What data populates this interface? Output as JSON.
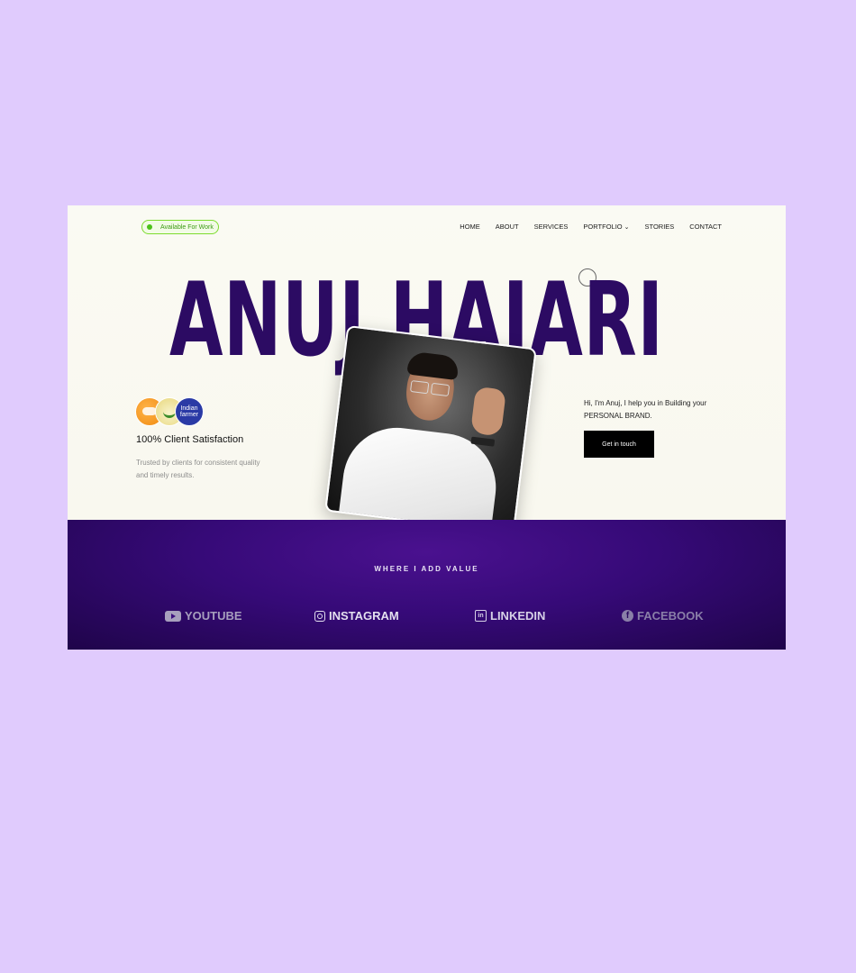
{
  "badge": {
    "label": "Available For Work"
  },
  "nav": {
    "items": [
      {
        "label": "HOME"
      },
      {
        "label": "ABOUT"
      },
      {
        "label": "SERVICES"
      },
      {
        "label": "PORTFOLIO",
        "has_dropdown": true
      },
      {
        "label": "STORIES"
      },
      {
        "label": "CONTACT"
      }
    ]
  },
  "hero": {
    "name": "ANUJ HAJARI",
    "logos": [
      "handshake-logo",
      "indian-farmer-emblem",
      "indian-farmer-logo"
    ],
    "logo_text": "Indian farmer",
    "satisfaction_title": "100% Client Satisfaction",
    "satisfaction_desc": "Trusted by clients for consistent quality and timely results.",
    "intro": "Hi, I'm Anuj, I help you in Building your PERSONAL BRAND.",
    "cta_label": "Get in touch"
  },
  "value": {
    "title": "WHERE I ADD VALUE",
    "platforms": [
      {
        "label": "YOUTUBE",
        "icon": "youtube-icon"
      },
      {
        "label": "INSTAGRAM",
        "icon": "instagram-icon"
      },
      {
        "label": "LINKEDIN",
        "icon": "linkedin-icon"
      },
      {
        "label": "FACEBOOK",
        "icon": "facebook-icon"
      }
    ]
  },
  "colors": {
    "background": "#e0cbfd",
    "name": "#2c0b63",
    "band": "#360a78",
    "badge_green": "#4cc21a",
    "cta": "#000000"
  }
}
